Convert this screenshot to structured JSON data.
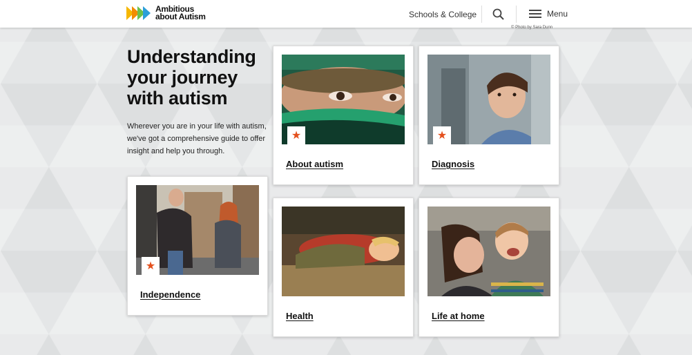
{
  "header": {
    "logo_line1": "Ambitious",
    "logo_line2": "about Autism",
    "nav_link": "Schools & College",
    "menu_label": "Menu"
  },
  "photo_credit": "© Photo by Sara Dunn",
  "intro": {
    "title": "Understanding your journey with autism",
    "body": "Wherever you are in your life with autism, we've got a comprehensive guide to offer insight and help you through."
  },
  "cards": [
    {
      "title": "About autism",
      "image": "child-eyes-green-hat-photo"
    },
    {
      "title": "Diagnosis",
      "image": "boy-at-window-photo"
    },
    {
      "title": "Independence",
      "image": "young-couple-street-photo"
    },
    {
      "title": "Health",
      "image": "sleeping-child-photo"
    },
    {
      "title": "Life at home",
      "image": "mother-and-son-laughing-photo"
    }
  ],
  "colors": {
    "accent_star": "#e4501d",
    "logo_yellow": "#f6b700",
    "logo_green": "#6cc04a",
    "logo_blue": "#2b9fd9"
  }
}
